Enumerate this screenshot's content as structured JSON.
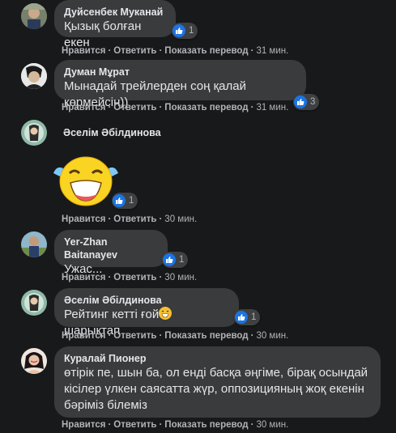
{
  "actions": {
    "like": "Нравится",
    "reply": "Ответить",
    "translate": "Показать перевод",
    "separator": "·"
  },
  "comments": [
    {
      "author": "Дуйсенбек Муканай",
      "text": "Қызық болған екен",
      "reaction_icon": "like-icon",
      "reaction_count": "1",
      "time": "31 мин."
    },
    {
      "author": "Думан Мұрат",
      "text": "Мынадай трейлерден соң қалай көрмейсің))",
      "reaction_icon": "like-icon",
      "reaction_count": "3",
      "time": "31 мин."
    },
    {
      "author": "Әселім Әбілдинова",
      "sticker": "laughing-tears-sticker",
      "reaction_icon": "like-icon",
      "reaction_count": "1",
      "time": "30 мин."
    },
    {
      "author": "Yer-Zhan Baitanayev",
      "text": "Ужас...",
      "reaction_icon": "like-icon",
      "reaction_count": "1",
      "time": "30 мин."
    },
    {
      "author": "Әселім Әбілдинова",
      "text_before": "Рейтинг кетті ғой",
      "inline_emoji": "grinning-sweat-emoji",
      "text_after": " шарықтап",
      "reaction_icon": "like-icon",
      "reaction_count": "1",
      "time": "30 мин."
    },
    {
      "author": "Куралай Пионер",
      "text_lines": [
        "өтірік пе, шын ба, ол енді басқа әңгіме, бірақ осындай",
        "кісілер үлкен саясатта жүр, оппозицияның жоқ екенін",
        "бәріміз білеміз"
      ],
      "time": "30 мин."
    }
  ],
  "colors": {
    "background": "#18191a",
    "bubble": "#3a3b3c",
    "text": "#e4e6eb",
    "secondary_text": "#b0b3b8",
    "like_blue": "#1b74e4"
  }
}
